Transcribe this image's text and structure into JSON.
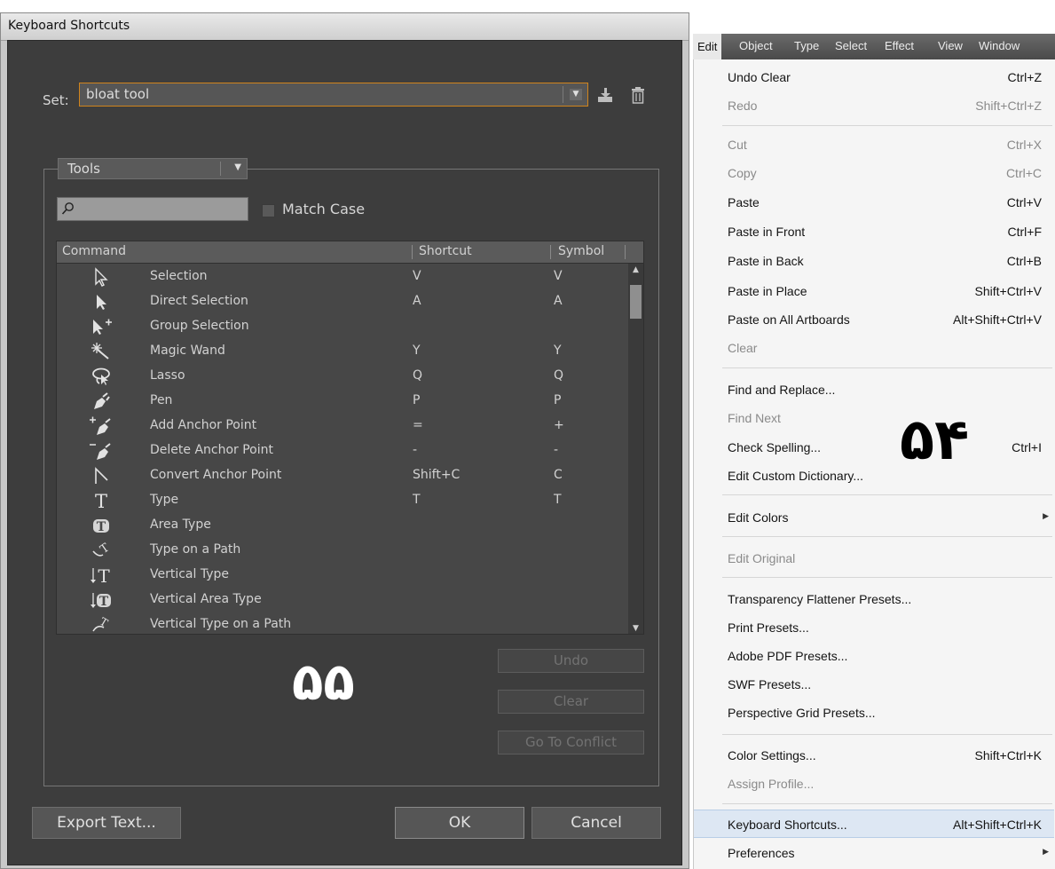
{
  "dialog": {
    "title": "Keyboard Shortcuts",
    "set_label": "Set:",
    "set_value": "bloat tool",
    "category_value": "Tools",
    "search_value": "",
    "match_case_label": "Match Case",
    "columns": {
      "command": "Command",
      "shortcut": "Shortcut",
      "symbol": "Symbol"
    },
    "rows": [
      {
        "icon": "selection-arrow-icon",
        "name": "Selection",
        "shortcut": "V",
        "symbol": "V"
      },
      {
        "icon": "direct-selection-icon",
        "name": "Direct Selection",
        "shortcut": "A",
        "symbol": "A"
      },
      {
        "icon": "group-selection-icon",
        "name": "Group Selection",
        "shortcut": "",
        "symbol": ""
      },
      {
        "icon": "magic-wand-icon",
        "name": "Magic Wand",
        "shortcut": "Y",
        "symbol": "Y"
      },
      {
        "icon": "lasso-icon",
        "name": "Lasso",
        "shortcut": "Q",
        "symbol": "Q"
      },
      {
        "icon": "pen-icon",
        "name": "Pen",
        "shortcut": "P",
        "symbol": "P"
      },
      {
        "icon": "add-anchor-point-icon",
        "name": "Add Anchor Point",
        "shortcut": "=",
        "symbol": "+"
      },
      {
        "icon": "delete-anchor-point-icon",
        "name": "Delete Anchor Point",
        "shortcut": "-",
        "symbol": "-"
      },
      {
        "icon": "convert-anchor-point-icon",
        "name": "Convert Anchor Point",
        "shortcut": "Shift+C",
        "symbol": "C"
      },
      {
        "icon": "type-icon",
        "name": "Type",
        "shortcut": "T",
        "symbol": "T"
      },
      {
        "icon": "area-type-icon",
        "name": "Area Type",
        "shortcut": "",
        "symbol": ""
      },
      {
        "icon": "type-on-path-icon",
        "name": "Type on a Path",
        "shortcut": "",
        "symbol": ""
      },
      {
        "icon": "vertical-type-icon",
        "name": "Vertical Type",
        "shortcut": "",
        "symbol": ""
      },
      {
        "icon": "vertical-area-type-icon",
        "name": "Vertical Area Type",
        "shortcut": "",
        "symbol": ""
      },
      {
        "icon": "vertical-type-on-path-icon",
        "name": "Vertical Type on a Path",
        "shortcut": "",
        "symbol": ""
      }
    ],
    "buttons": {
      "undo": "Undo",
      "clear": "Clear",
      "go_to_conflict": "Go To Conflict",
      "export_text": "Export Text...",
      "ok": "OK",
      "cancel": "Cancel"
    },
    "overlay_number": "۵۵"
  },
  "menubar": {
    "items": [
      "Edit",
      "Object",
      "Type",
      "Select",
      "Effect",
      "View",
      "Window"
    ]
  },
  "menu": {
    "overlay_number": "۵۴",
    "items": [
      {
        "label": "Undo Clear",
        "shortcut": "Ctrl+Z",
        "disabled": false
      },
      {
        "label": "Redo",
        "shortcut": "Shift+Ctrl+Z",
        "disabled": true
      },
      {
        "label": "Cut",
        "shortcut": "Ctrl+X",
        "disabled": true
      },
      {
        "label": "Copy",
        "shortcut": "Ctrl+C",
        "disabled": true
      },
      {
        "label": "Paste",
        "shortcut": "Ctrl+V",
        "disabled": false
      },
      {
        "label": "Paste in Front",
        "shortcut": "Ctrl+F",
        "disabled": false
      },
      {
        "label": "Paste in Back",
        "shortcut": "Ctrl+B",
        "disabled": false
      },
      {
        "label": "Paste in Place",
        "shortcut": "Shift+Ctrl+V",
        "disabled": false
      },
      {
        "label": "Paste on All Artboards",
        "shortcut": "Alt+Shift+Ctrl+V",
        "disabled": false
      },
      {
        "label": "Clear",
        "shortcut": "",
        "disabled": true
      },
      {
        "label": "Find and Replace...",
        "shortcut": "",
        "disabled": false
      },
      {
        "label": "Find Next",
        "shortcut": "",
        "disabled": true
      },
      {
        "label": "Check Spelling...",
        "shortcut": "Ctrl+I",
        "disabled": false
      },
      {
        "label": "Edit Custom Dictionary...",
        "shortcut": "",
        "disabled": false
      },
      {
        "label": "Edit Colors",
        "shortcut": "",
        "disabled": false
      },
      {
        "label": "Edit Original",
        "shortcut": "",
        "disabled": true
      },
      {
        "label": "Transparency Flattener Presets...",
        "shortcut": "",
        "disabled": false
      },
      {
        "label": "Print Presets...",
        "shortcut": "",
        "disabled": false
      },
      {
        "label": "Adobe PDF Presets...",
        "shortcut": "",
        "disabled": false
      },
      {
        "label": "SWF Presets...",
        "shortcut": "",
        "disabled": false
      },
      {
        "label": "Perspective Grid Presets...",
        "shortcut": "",
        "disabled": false
      },
      {
        "label": "Color Settings...",
        "shortcut": "Shift+Ctrl+K",
        "disabled": false
      },
      {
        "label": "Assign Profile...",
        "shortcut": "",
        "disabled": true
      },
      {
        "label": "Keyboard Shortcuts...",
        "shortcut": "Alt+Shift+Ctrl+K",
        "disabled": false
      },
      {
        "label": "Preferences",
        "shortcut": "",
        "disabled": false
      }
    ]
  }
}
